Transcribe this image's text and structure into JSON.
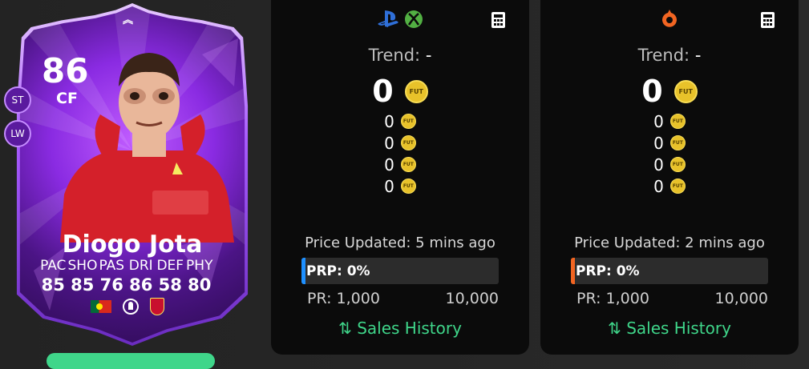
{
  "card": {
    "rating": "86",
    "position": "CF",
    "alt_positions": [
      "ST",
      "LW"
    ],
    "name": "Diogo Jota",
    "stats": [
      {
        "label": "PAC",
        "value": "85"
      },
      {
        "label": "SHO",
        "value": "85"
      },
      {
        "label": "PAS",
        "value": "76"
      },
      {
        "label": "DRI",
        "value": "86"
      },
      {
        "label": "DEF",
        "value": "58"
      },
      {
        "label": "PHY",
        "value": "80"
      }
    ],
    "nation_icon": "portugal-flag-icon",
    "league_icon": "premier-league-icon",
    "club_icon": "liverpool-crest-icon"
  },
  "panels": [
    {
      "platform": "console",
      "platform_icons": [
        "playstation-icon",
        "xbox-icon"
      ],
      "trend_label": "Trend:",
      "trend_value": "-",
      "price": "0",
      "older_prices": [
        "0",
        "0",
        "0",
        "0"
      ],
      "coin_label": "FUT",
      "updated": "Price Updated: 5 mins ago",
      "prp": "PRP: 0%",
      "accent": "#1e90ff",
      "pr_min": "PR: 1,000",
      "pr_max": "10,000",
      "sales_label": "Sales History"
    },
    {
      "platform": "pc",
      "platform_icons": [
        "origin-icon"
      ],
      "trend_label": "Trend:",
      "trend_value": "-",
      "price": "0",
      "older_prices": [
        "0",
        "0",
        "0",
        "0"
      ],
      "coin_label": "FUT",
      "updated": "Price Updated: 2 mins ago",
      "prp": "PRP: 0%",
      "accent": "#f26522",
      "pr_min": "PR: 1,000",
      "pr_max": "10,000",
      "sales_label": "Sales History"
    }
  ],
  "colors": {
    "card_purple": "#8a2be2",
    "sales_green": "#3fd68a",
    "panel_bg": "#0b0b0b"
  }
}
